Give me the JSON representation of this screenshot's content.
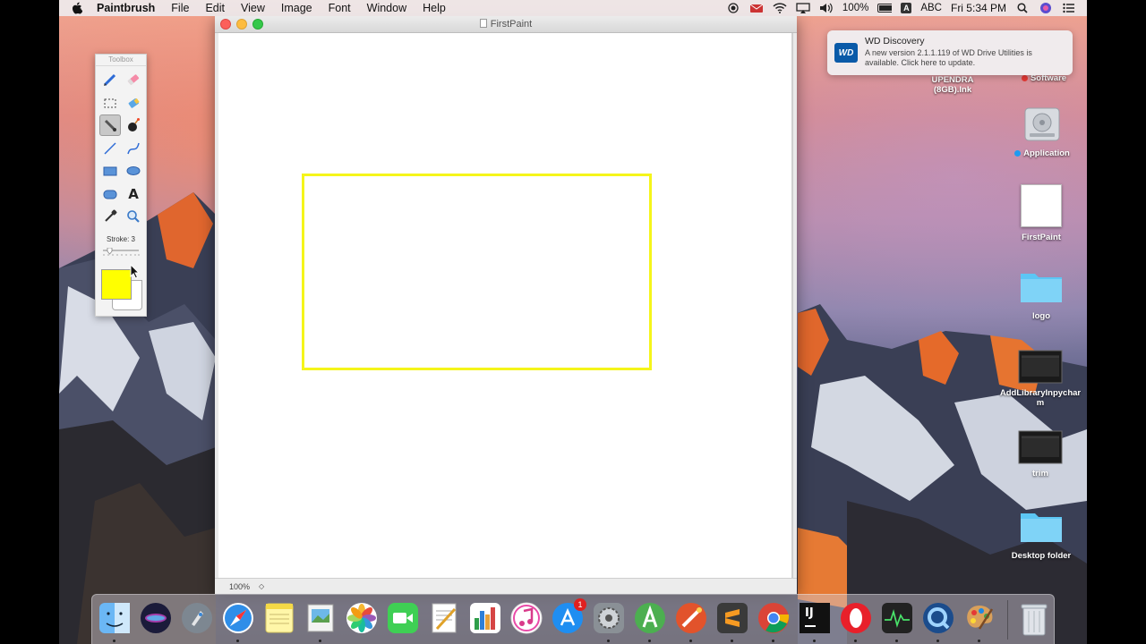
{
  "menubar": {
    "app_name": "Paintbrush",
    "items": [
      "File",
      "Edit",
      "View",
      "Image",
      "Font",
      "Window",
      "Help"
    ],
    "battery": "100%",
    "input_source": "ABC",
    "input_badge": "A",
    "clock": "Fri 5:34 PM"
  },
  "window": {
    "title": "FirstPaint",
    "zoom": "100%",
    "stepper": "◇"
  },
  "toolbox": {
    "title": "Toolbox",
    "stroke_label": "Stroke: 3",
    "foreground_color": "#ffff00",
    "background_color": "#ffffff",
    "text_tool_glyph": "A"
  },
  "notification": {
    "logo": "WD",
    "title": "WD Discovery",
    "body": "A new version 2.1.1.119 of WD Drive Utilities is available. Click here to update."
  },
  "desktop": {
    "icons": [
      {
        "label": "UPENDRA (8GB).lnk"
      },
      {
        "label": "Software",
        "tag_color": "#e53935"
      },
      {
        "label": "Application",
        "tag_color": "#1e9bf0"
      },
      {
        "label": "FirstPaint"
      },
      {
        "label": "logo"
      },
      {
        "label": "AddLibraryInpycharm"
      },
      {
        "label": "trim"
      },
      {
        "label": "Desktop folder"
      }
    ]
  },
  "dock": {
    "appstore_badge": "1",
    "intellij_text": "IJ"
  }
}
